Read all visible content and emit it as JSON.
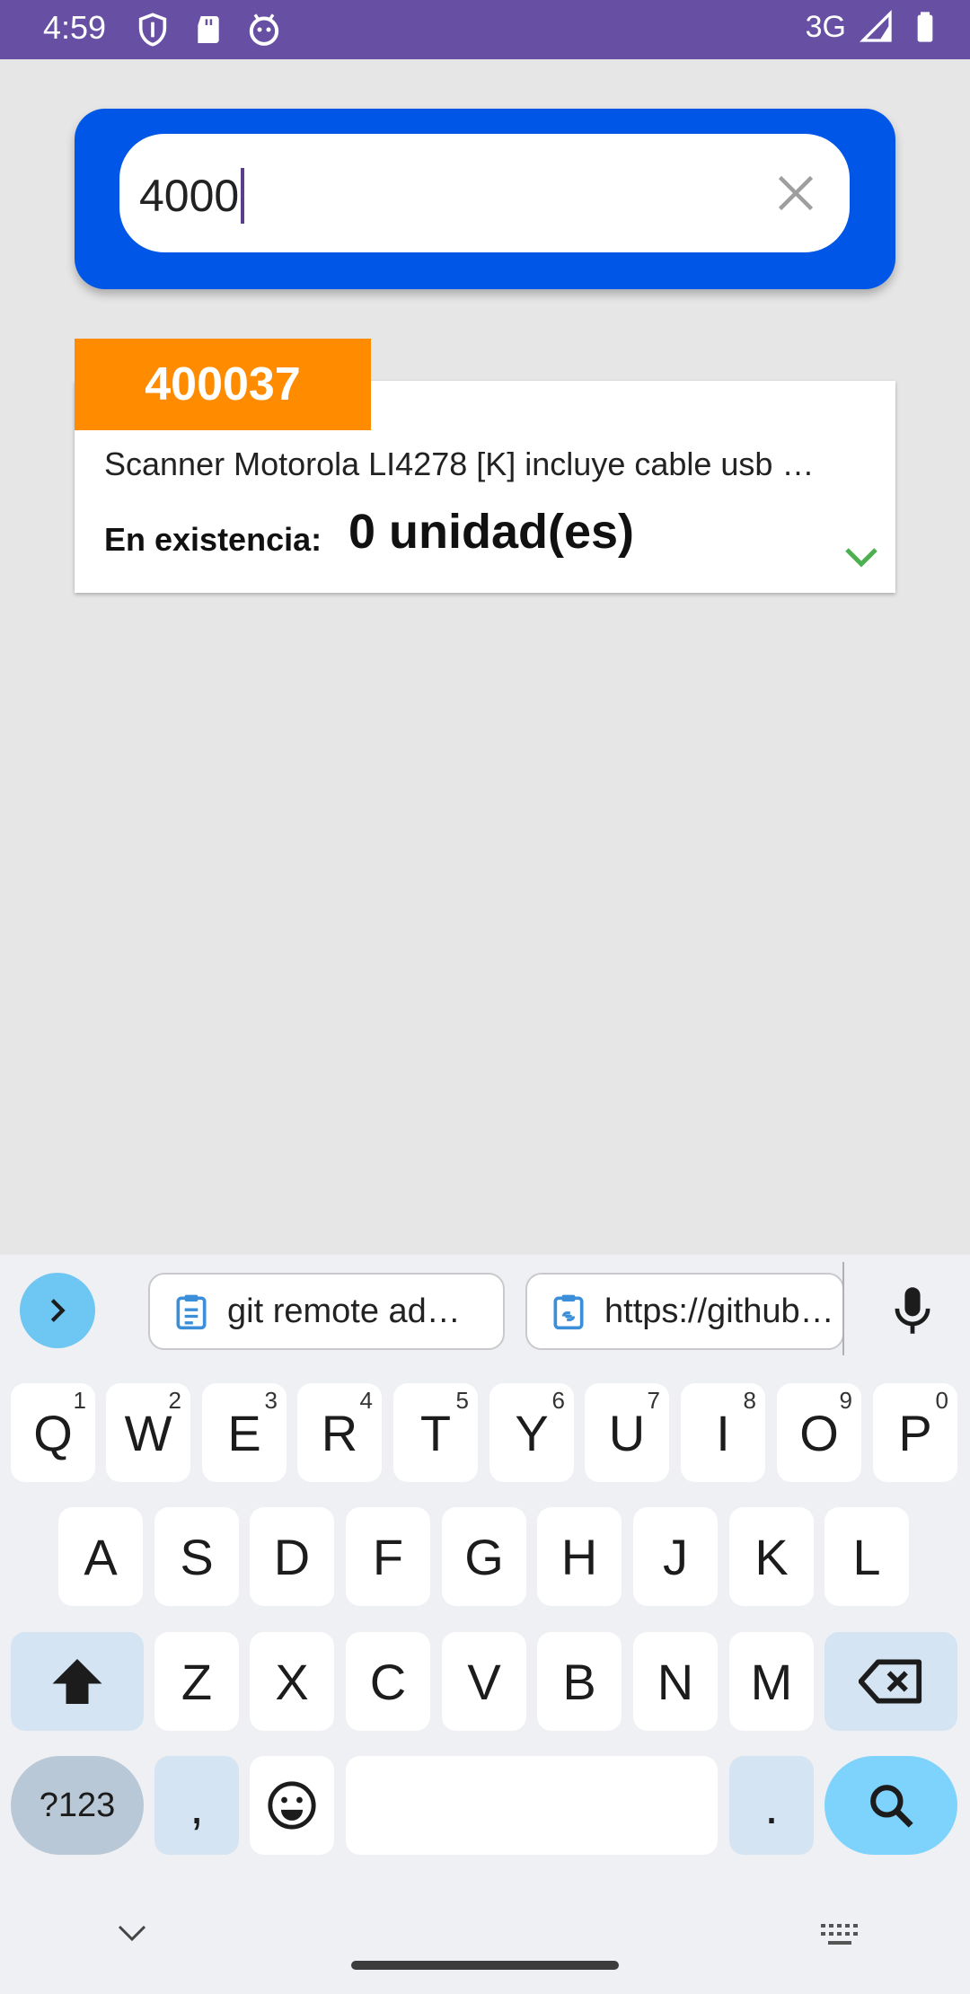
{
  "status_bar": {
    "time": "4:59",
    "network": "3G"
  },
  "search": {
    "value": "4000"
  },
  "result": {
    "code": "400037",
    "description": "Scanner Motorola LI4278 [K] incluye cable usb …",
    "stock_label": "En existencia:",
    "stock_value": "0 unidad(es)"
  },
  "keyboard": {
    "clipboard_chips": [
      "git remote ad…",
      "https://github…"
    ],
    "row1": [
      {
        "k": "Q",
        "n": "1"
      },
      {
        "k": "W",
        "n": "2"
      },
      {
        "k": "E",
        "n": "3"
      },
      {
        "k": "R",
        "n": "4"
      },
      {
        "k": "T",
        "n": "5"
      },
      {
        "k": "Y",
        "n": "6"
      },
      {
        "k": "U",
        "n": "7"
      },
      {
        "k": "I",
        "n": "8"
      },
      {
        "k": "O",
        "n": "9"
      },
      {
        "k": "P",
        "n": "0"
      }
    ],
    "row2": [
      "A",
      "S",
      "D",
      "F",
      "G",
      "H",
      "J",
      "K",
      "L"
    ],
    "row3": [
      "Z",
      "X",
      "C",
      "V",
      "B",
      "N",
      "M"
    ],
    "symbols_label": "?123",
    "comma": ",",
    "period": "."
  },
  "colors": {
    "status_bar": "#6750a4",
    "search_panel": "#0057e7",
    "code_tab": "#ff8c00",
    "chevron": "#4caf50",
    "search_key": "#7dd3fc"
  }
}
